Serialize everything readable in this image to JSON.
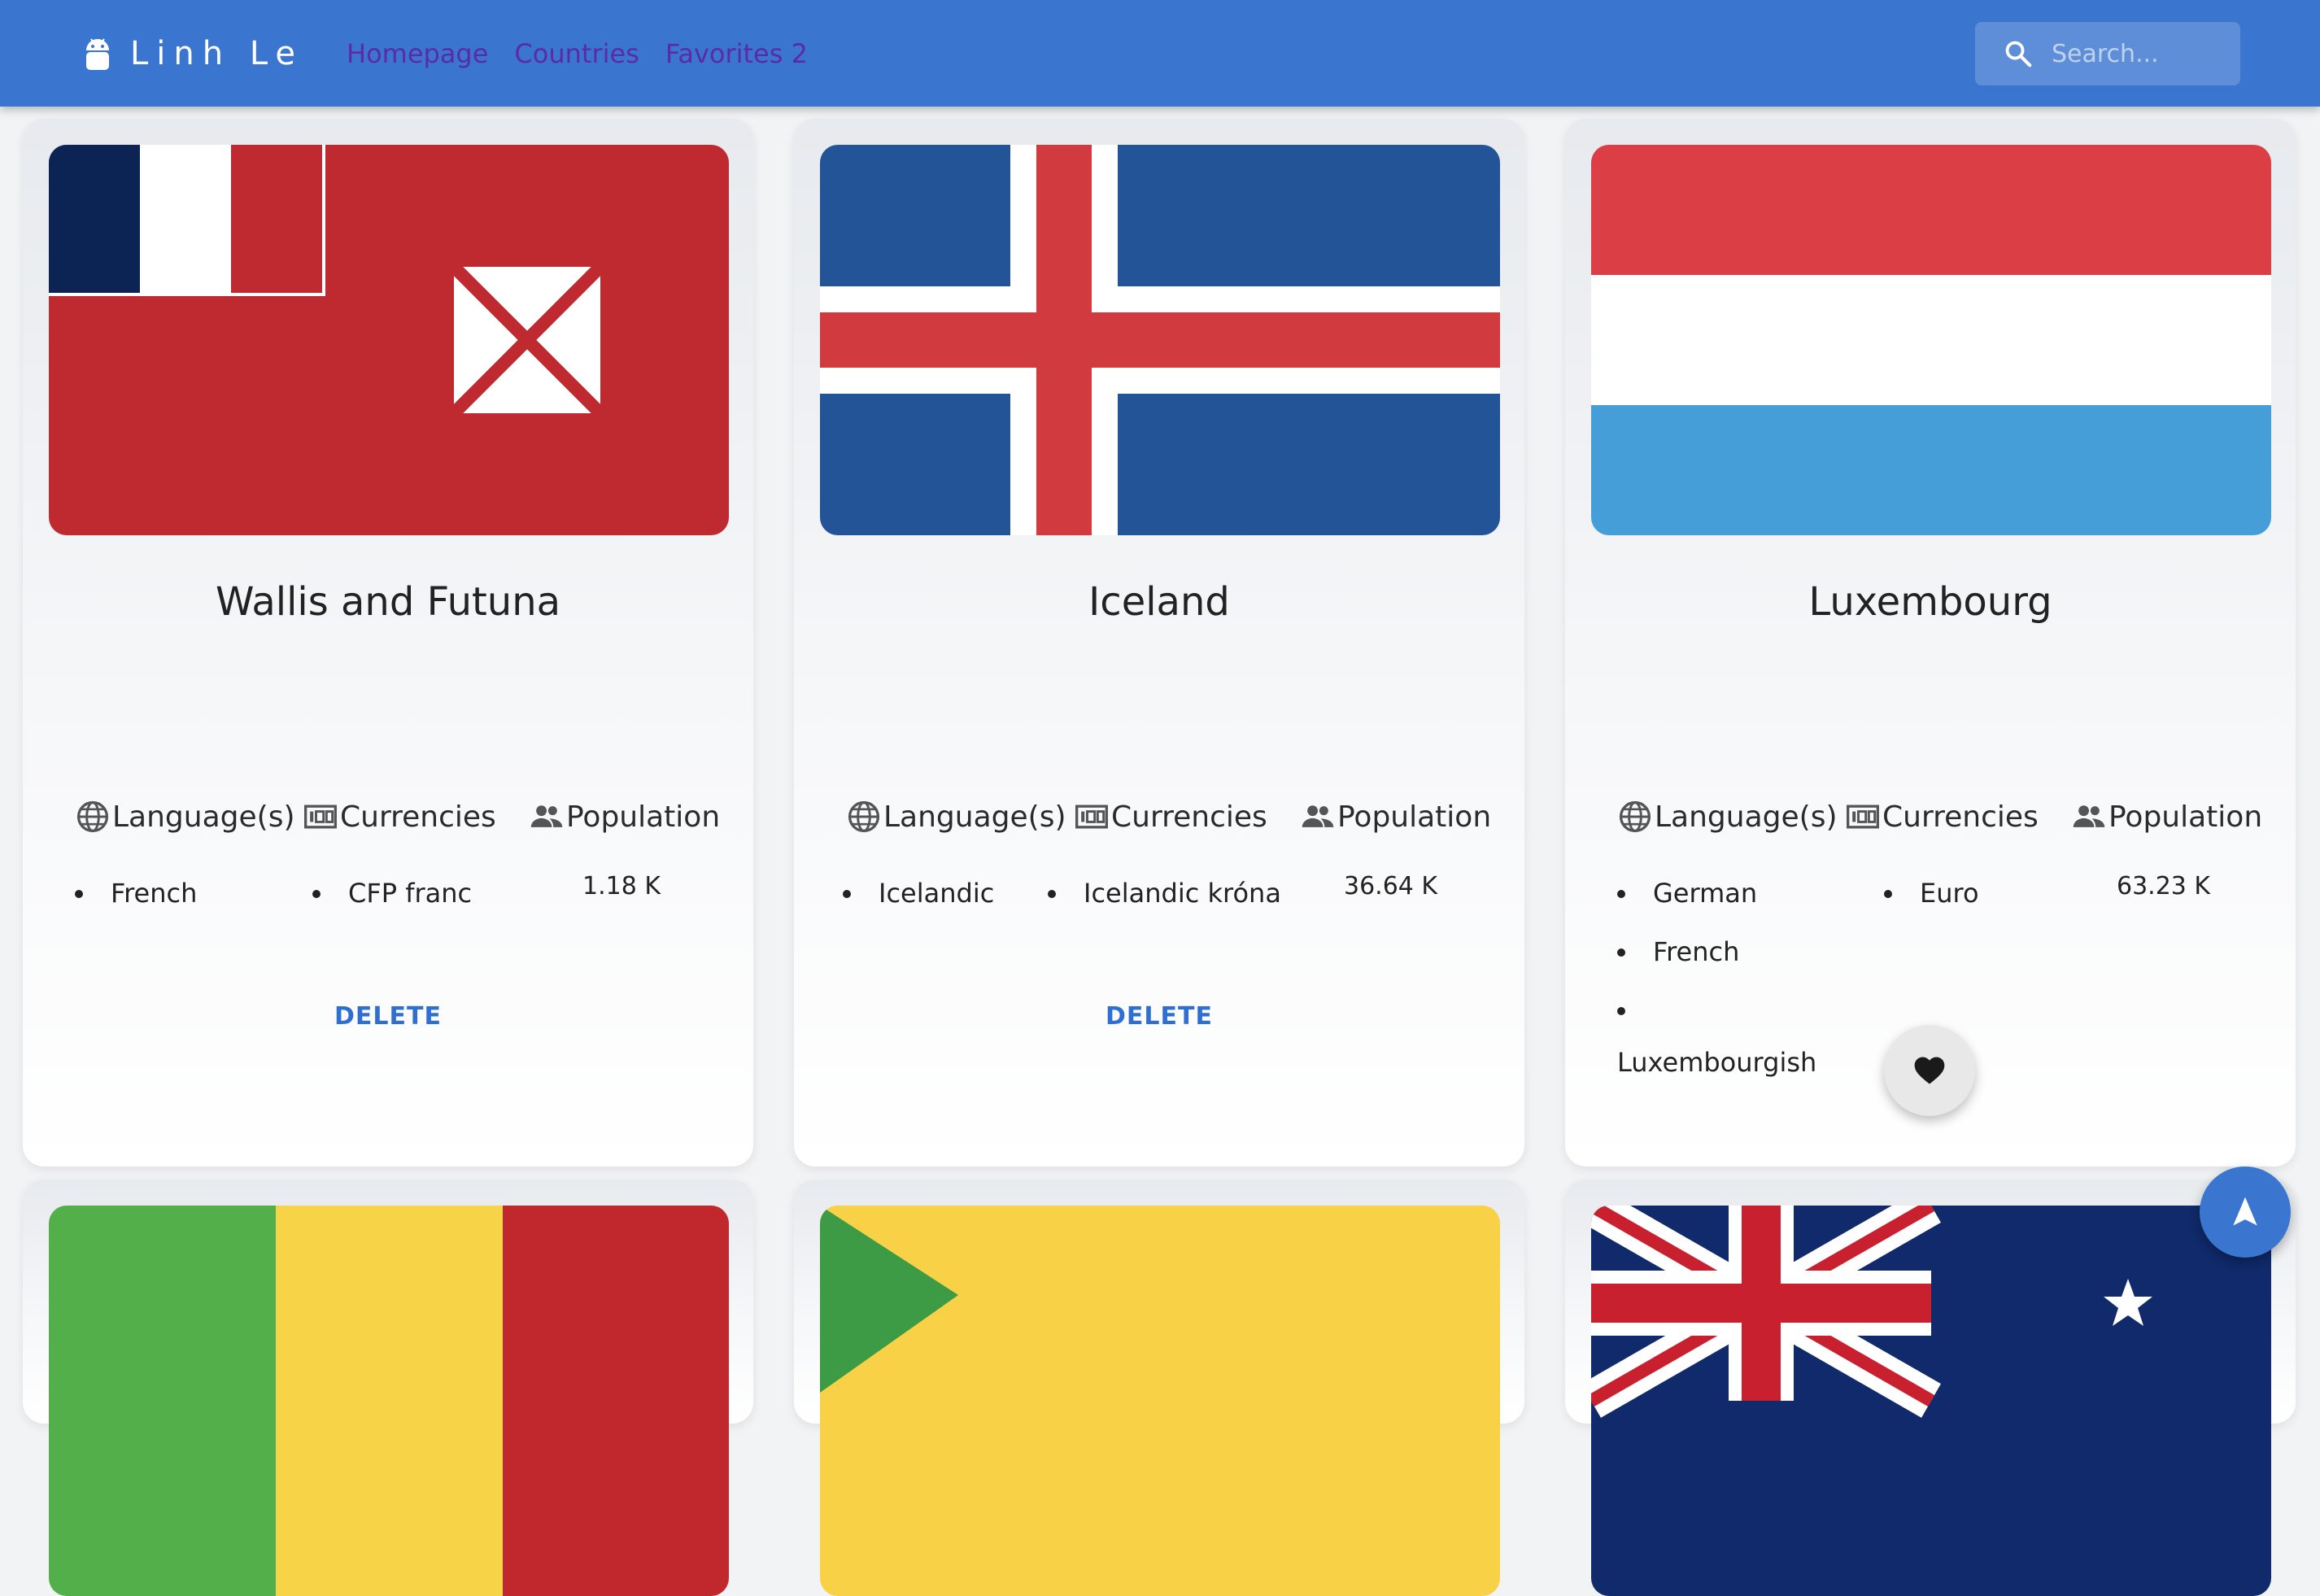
{
  "header": {
    "brand": "Linh Le",
    "nav": [
      "Homepage",
      "Countries",
      "Favorites 2"
    ],
    "search_placeholder": "Search..."
  },
  "labels": {
    "languages": "Language(s)",
    "currencies": "Currencies",
    "population": "Population",
    "delete": "DELETE"
  },
  "cards": [
    {
      "name": "Wallis and Futuna",
      "languages": [
        "French"
      ],
      "currencies": [
        "CFP franc"
      ],
      "population": "1.18 K"
    },
    {
      "name": "Iceland",
      "languages": [
        "Icelandic"
      ],
      "currencies": [
        "Icelandic króna"
      ],
      "population": "36.64 K"
    },
    {
      "name": "Luxembourg",
      "languages": [
        "German",
        "French",
        "Luxembourgish"
      ],
      "currencies": [
        "Euro"
      ],
      "population": "63.23 K"
    }
  ],
  "icons": {
    "brand": "android-icon",
    "search": "search-icon",
    "languages": "globe-icon",
    "currencies": "money-icon",
    "population": "people-icon",
    "favorite": "heart-icon",
    "scroll_top": "navigation-arrow-icon"
  },
  "colors": {
    "appbar": "#3a76cf",
    "link": "#4a1fa0",
    "delete": "#2e6fd1"
  }
}
